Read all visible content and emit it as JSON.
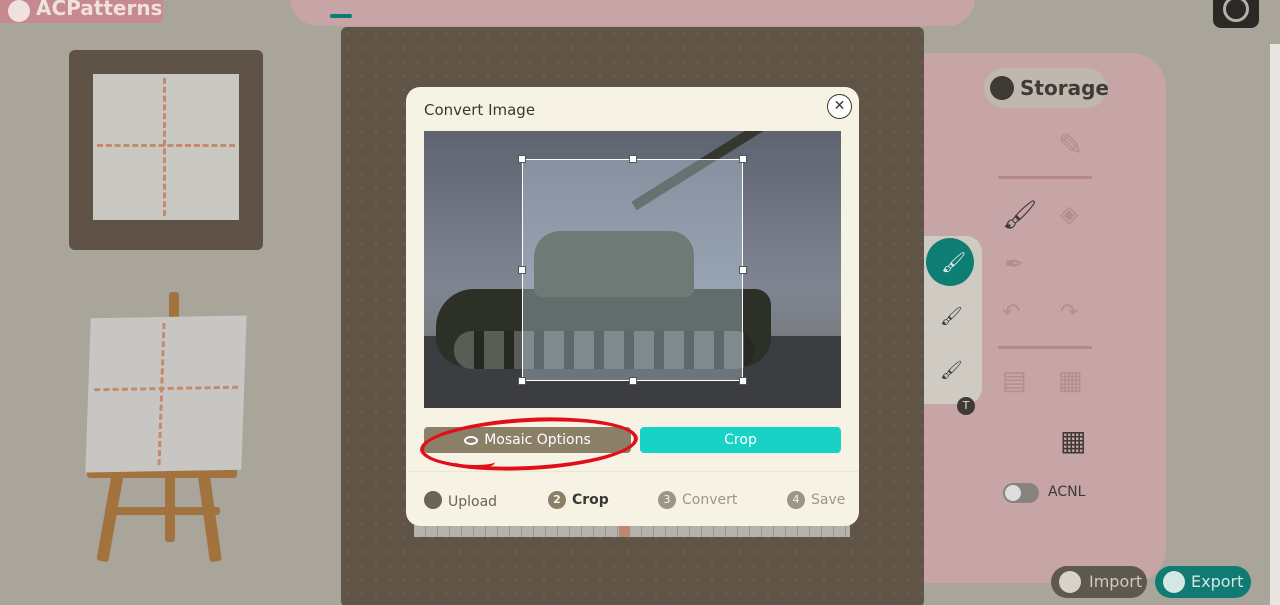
{
  "app": {
    "brand": "ACPatterns"
  },
  "sidebar_right": {
    "storage_label": "Storage",
    "toggle_label": "ACNL",
    "import_label": "Import",
    "export_label": "Export"
  },
  "modal": {
    "title": "Convert Image",
    "close_icon": "close-icon",
    "mosaic_label": "Mosaic Options",
    "crop_label": "Crop",
    "steps": [
      {
        "num": "",
        "label": "Upload",
        "state": "done"
      },
      {
        "num": "2",
        "label": "Crop",
        "state": "active"
      },
      {
        "num": "3",
        "label": "Convert",
        "state": "pending"
      },
      {
        "num": "4",
        "label": "Save",
        "state": "pending"
      }
    ]
  },
  "colors": {
    "accent_teal": "#18d2c5",
    "mosaic_brown": "#8b7f68",
    "annotation_red": "#e0101a",
    "panel_pink": "#c7a4a5"
  }
}
